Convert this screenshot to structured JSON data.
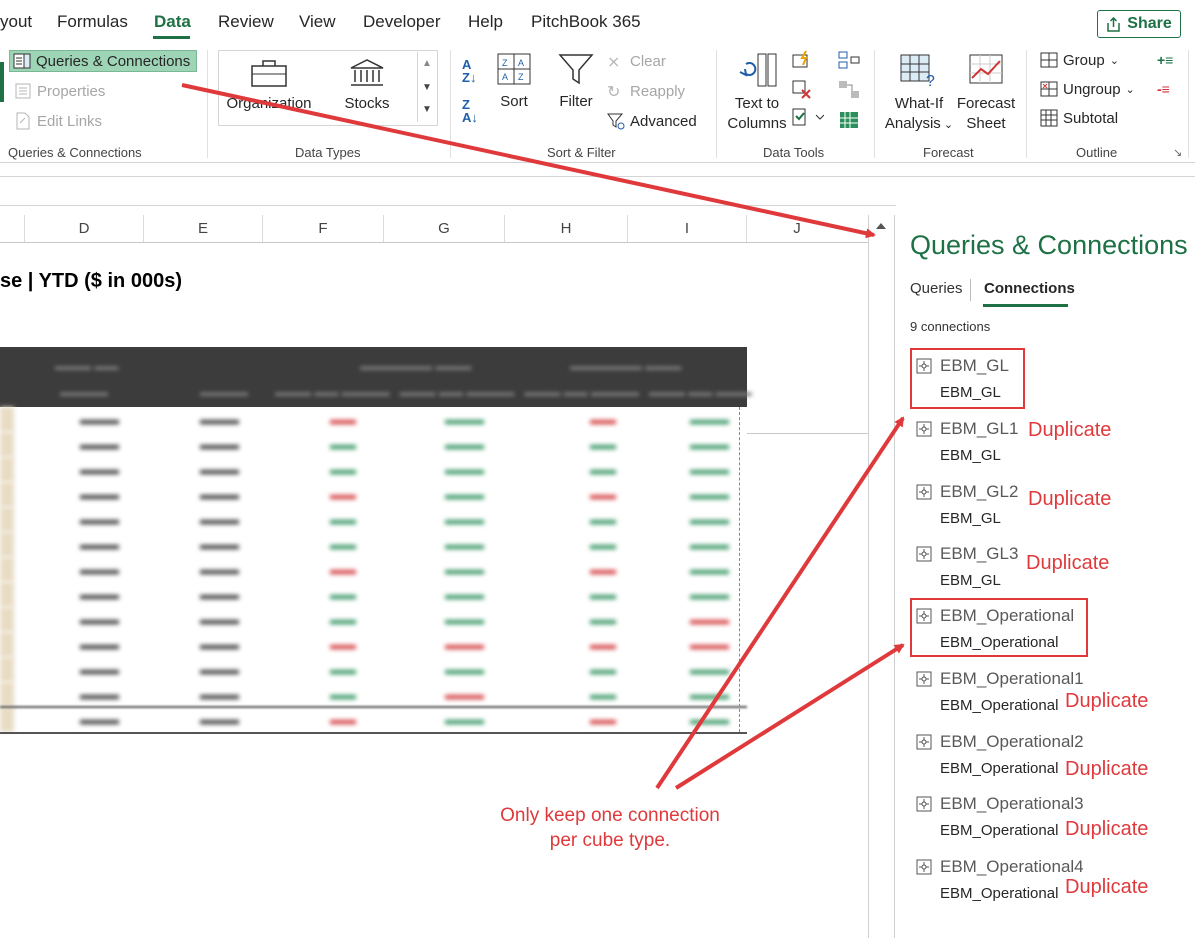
{
  "ribbon_tabs": {
    "layout": "yout",
    "formulas": "Formulas",
    "data": "Data",
    "review": "Review",
    "view": "View",
    "developer": "Developer",
    "help": "Help",
    "pitchbook": "PitchBook 365",
    "share": "Share"
  },
  "queries_group": {
    "queries_connections": "Queries & Connections",
    "properties": "Properties",
    "edit_links": "Edit Links",
    "label": "Queries & Connections"
  },
  "data_types_group": {
    "organization": "Organization",
    "stocks": "Stocks",
    "label": "Data Types"
  },
  "sort_filter_group": {
    "sort": "Sort",
    "filter": "Filter",
    "clear": "Clear",
    "reapply": "Reapply",
    "advanced": "Advanced",
    "label": "Sort & Filter"
  },
  "data_tools_group": {
    "text_to_columns_line1": "Text to",
    "text_to_columns_line2": "Columns",
    "label": "Data Tools"
  },
  "forecast_group": {
    "what_if_line1": "What-If",
    "what_if_line2": "Analysis",
    "forecast_sheet_line1": "Forecast",
    "forecast_sheet_line2": "Sheet",
    "label": "Forecast"
  },
  "outline_group": {
    "group": "Group",
    "ungroup": "Ungroup",
    "subtotal": "Subtotal",
    "label": "Outline"
  },
  "sheet": {
    "columns": [
      "D",
      "E",
      "F",
      "G",
      "H",
      "I",
      "J"
    ],
    "title": "se | YTD ($ in 000s)"
  },
  "pane": {
    "title": "Queries & Connections",
    "tab_queries": "Queries",
    "tab_connections": "Connections",
    "count": "9 connections",
    "connections": [
      {
        "name": "EBM_GL",
        "sub": "EBM_GL"
      },
      {
        "name": "EBM_GL1",
        "sub": "EBM_GL"
      },
      {
        "name": "EBM_GL2",
        "sub": "EBM_GL"
      },
      {
        "name": "EBM_GL3",
        "sub": "EBM_GL"
      },
      {
        "name": "EBM_Operational",
        "sub": "EBM_Operational"
      },
      {
        "name": "EBM_Operational1",
        "sub": "EBM_Operational"
      },
      {
        "name": "EBM_Operational2",
        "sub": "EBM_Operational"
      },
      {
        "name": "EBM_Operational3",
        "sub": "EBM_Operational"
      },
      {
        "name": "EBM_Operational4",
        "sub": "EBM_Operational"
      }
    ]
  },
  "annotations": {
    "duplicate": "Duplicate",
    "note_line1": "Only keep one connection",
    "note_line2": "per cube type.",
    "color": "#e0393c"
  },
  "colors": {
    "accent": "#1e7145",
    "highlight": "#9fd5b7"
  }
}
